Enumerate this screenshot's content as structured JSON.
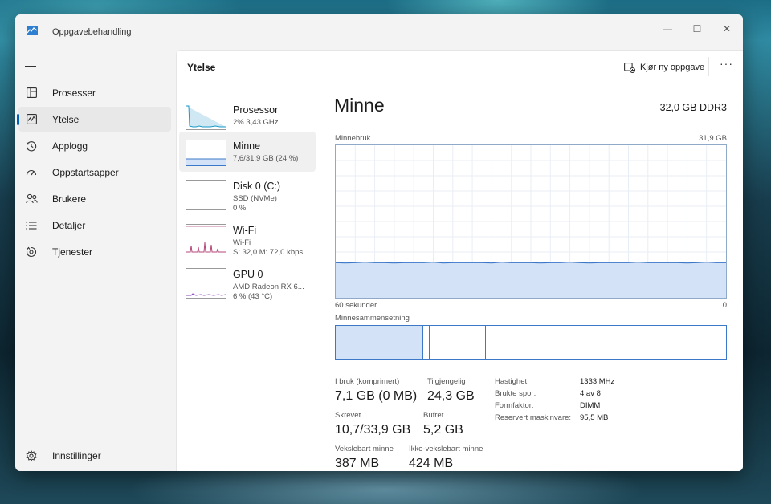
{
  "window": {
    "title": "Oppgavebehandling",
    "controls": {
      "minimize": "—",
      "maximize": "☐",
      "close": "✕"
    }
  },
  "nav": {
    "items": [
      {
        "label": "Prosesser",
        "icon": "processes-grid-icon"
      },
      {
        "label": "Ytelse",
        "icon": "performance-chart-icon",
        "active": true
      },
      {
        "label": "Applogg",
        "icon": "history-icon"
      },
      {
        "label": "Oppstartsapper",
        "icon": "startup-speedometer-icon"
      },
      {
        "label": "Brukere",
        "icon": "users-icon"
      },
      {
        "label": "Detaljer",
        "icon": "details-list-icon"
      },
      {
        "label": "Tjenester",
        "icon": "services-puzzle-icon"
      }
    ],
    "settings_label": "Innstillinger"
  },
  "header": {
    "title": "Ytelse",
    "run_task_label": "Kjør ny oppgave",
    "more_label": "···"
  },
  "resources": [
    {
      "name": "Prosessor",
      "lines": [
        "2%  3,43 GHz"
      ]
    },
    {
      "name": "Minne",
      "lines": [
        "7,6/31,9 GB (24 %)"
      ],
      "active": true
    },
    {
      "name": "Disk 0 (C:)",
      "lines": [
        "SSD (NVMe)",
        "0 %"
      ]
    },
    {
      "name": "Wi-Fi",
      "lines": [
        "Wi-Fi",
        "S: 32,0  M: 72,0 kbps"
      ]
    },
    {
      "name": "GPU 0",
      "lines": [
        "AMD Radeon RX 6...",
        "6 %  (43 °C)"
      ]
    }
  ],
  "memory": {
    "title": "Minne",
    "spec": "32,0 GB DDR3",
    "usage_label": "Minnebruk",
    "usage_max": "31,9 GB",
    "time_left": "60 sekunder",
    "time_right": "0",
    "usage_fraction": 0.23,
    "composition_label": "Minnesammensetning",
    "composition": {
      "in_use": 0.225,
      "modified": 0.016,
      "standby": 0.144
    },
    "stats": {
      "in_use_label": "I bruk (komprimert)",
      "in_use_value": "7,1 GB (0 MB)",
      "available_label": "Tilgjengelig",
      "available_value": "24,3 GB",
      "committed_label": "Skrevet",
      "committed_value": "10,7/33,9 GB",
      "cached_label": "Bufret",
      "cached_value": "5,2 GB",
      "paged_label": "Vekslebart minne",
      "paged_value": "387 MB",
      "nonpaged_label": "Ikke-vekslebart minne",
      "nonpaged_value": "424 MB"
    },
    "details": [
      {
        "label": "Hastighet:",
        "value": "1333 MHz"
      },
      {
        "label": "Brukte spor:",
        "value": "4 av 8"
      },
      {
        "label": "Formfaktor:",
        "value": "DIMM"
      },
      {
        "label": "Reservert maskinvare:",
        "value": "95,5 MB"
      }
    ]
  },
  "colors": {
    "accent": "#005fb8",
    "memory_fill": "#d3e2f7",
    "memory_line": "#3c78c8",
    "cpu_line": "#1a9ac9",
    "wifi_line": "#b5477a",
    "gpu_line": "#8a46b8"
  }
}
